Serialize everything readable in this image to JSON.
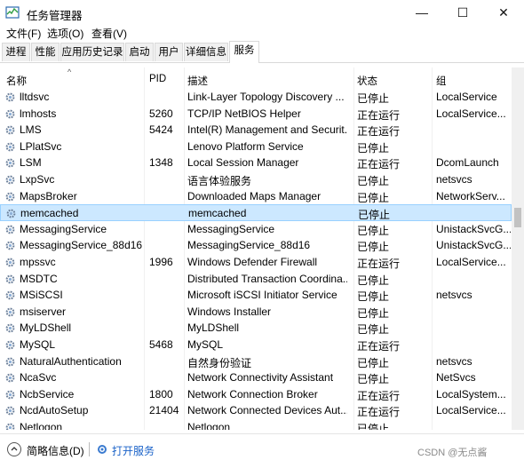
{
  "window": {
    "title": "任务管理器",
    "minimize_glyph": "—",
    "maximize_glyph": "☐",
    "close_glyph": "✕"
  },
  "menu": [
    "文件(F)",
    "选项(O)",
    "查看(V)"
  ],
  "tabs": [
    "进程",
    "性能",
    "应用历史记录",
    "启动",
    "用户",
    "详细信息",
    "服务"
  ],
  "active_tab": "服务",
  "columns": {
    "name": "名称",
    "pid": "PID",
    "desc": "描述",
    "status": "状态",
    "group": "组"
  },
  "rows": [
    {
      "name": "lltdsvc",
      "pid": "",
      "desc": "Link-Layer Topology Discovery ...",
      "status": "已停止",
      "group": "LocalService"
    },
    {
      "name": "lmhosts",
      "pid": "5260",
      "desc": "TCP/IP NetBIOS Helper",
      "status": "正在运行",
      "group": "LocalService..."
    },
    {
      "name": "LMS",
      "pid": "5424",
      "desc": "Intel(R) Management and Securit...",
      "status": "正在运行",
      "group": ""
    },
    {
      "name": "LPlatSvc",
      "pid": "",
      "desc": "Lenovo Platform Service",
      "status": "已停止",
      "group": ""
    },
    {
      "name": "LSM",
      "pid": "1348",
      "desc": "Local Session Manager",
      "status": "正在运行",
      "group": "DcomLaunch"
    },
    {
      "name": "LxpSvc",
      "pid": "",
      "desc": "语言体验服务",
      "status": "已停止",
      "group": "netsvcs"
    },
    {
      "name": "MapsBroker",
      "pid": "",
      "desc": "Downloaded Maps Manager",
      "status": "已停止",
      "group": "NetworkServ..."
    },
    {
      "name": "memcached",
      "pid": "",
      "desc": "memcached",
      "status": "已停止",
      "group": "",
      "selected": true
    },
    {
      "name": "MessagingService",
      "pid": "",
      "desc": "MessagingService",
      "status": "已停止",
      "group": "UnistackSvcG..."
    },
    {
      "name": "MessagingService_88d16",
      "pid": "",
      "desc": "MessagingService_88d16",
      "status": "已停止",
      "group": "UnistackSvcG..."
    },
    {
      "name": "mpssvc",
      "pid": "1996",
      "desc": "Windows Defender Firewall",
      "status": "正在运行",
      "group": "LocalService..."
    },
    {
      "name": "MSDTC",
      "pid": "",
      "desc": "Distributed Transaction Coordina...",
      "status": "已停止",
      "group": ""
    },
    {
      "name": "MSiSCSI",
      "pid": "",
      "desc": "Microsoft iSCSI Initiator Service",
      "status": "已停止",
      "group": "netsvcs"
    },
    {
      "name": "msiserver",
      "pid": "",
      "desc": "Windows Installer",
      "status": "已停止",
      "group": ""
    },
    {
      "name": "MyLDShell",
      "pid": "",
      "desc": "MyLDShell",
      "status": "已停止",
      "group": ""
    },
    {
      "name": "MySQL",
      "pid": "5468",
      "desc": "MySQL",
      "status": "正在运行",
      "group": ""
    },
    {
      "name": "NaturalAuthentication",
      "pid": "",
      "desc": "自然身份验证",
      "status": "已停止",
      "group": "netsvcs"
    },
    {
      "name": "NcaSvc",
      "pid": "",
      "desc": "Network Connectivity Assistant",
      "status": "已停止",
      "group": "NetSvcs"
    },
    {
      "name": "NcbService",
      "pid": "1800",
      "desc": "Network Connection Broker",
      "status": "正在运行",
      "group": "LocalSystem..."
    },
    {
      "name": "NcdAutoSetup",
      "pid": "21404",
      "desc": "Network Connected Devices Aut...",
      "status": "正在运行",
      "group": "LocalService..."
    },
    {
      "name": "Netlogon",
      "pid": "",
      "desc": "Netlogon",
      "status": "已停止",
      "group": ""
    }
  ],
  "footer": {
    "brief_label": "简略信息(D)",
    "open_services_label": "打开服务",
    "watermark": "CSDN @无点酱"
  }
}
